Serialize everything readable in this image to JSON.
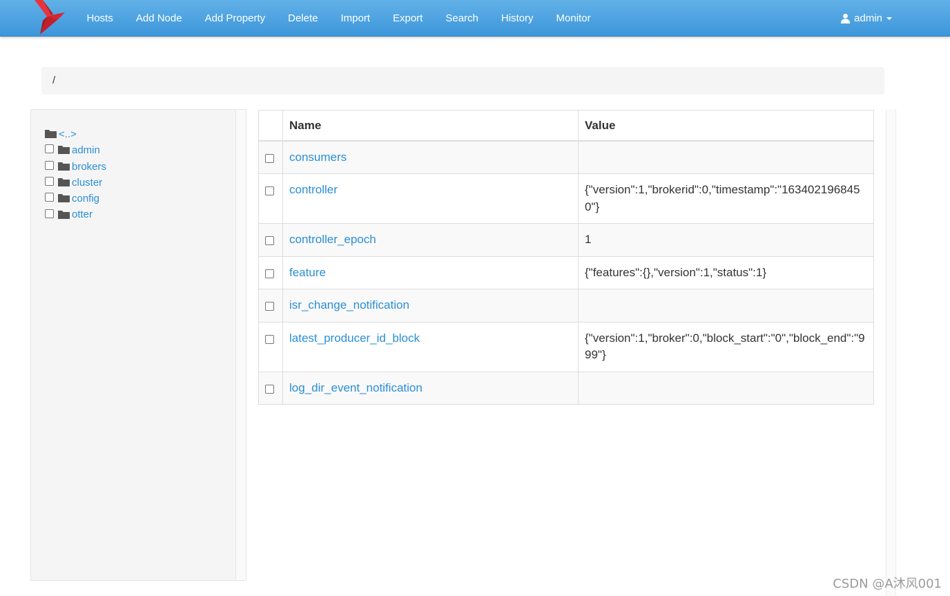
{
  "navbar": {
    "brand_icon": "bird-logo-icon",
    "links": [
      "Hosts",
      "Add Node",
      "Add Property",
      "Delete",
      "Import",
      "Export",
      "Search",
      "History",
      "Monitor"
    ],
    "user": {
      "icon": "user-icon",
      "name": "admin"
    }
  },
  "breadcrumb": {
    "path": "/"
  },
  "tree": {
    "parent_label": "<..>",
    "items": [
      {
        "label": "admin",
        "checked": false
      },
      {
        "label": "brokers",
        "checked": false
      },
      {
        "label": "cluster",
        "checked": false
      },
      {
        "label": "config",
        "checked": false
      },
      {
        "label": "otter",
        "checked": false
      }
    ]
  },
  "table": {
    "headers": {
      "name": "Name",
      "value": "Value"
    },
    "rows": [
      {
        "name": "consumers",
        "value": "",
        "checked": false
      },
      {
        "name": "controller",
        "value": "{\"version\":1,\"brokerid\":0,\"timestamp\":\"1634021968450\"}",
        "checked": false
      },
      {
        "name": "controller_epoch",
        "value": "1",
        "checked": false
      },
      {
        "name": "feature",
        "value": "{\"features\":{},\"version\":1,\"status\":1}",
        "checked": false
      },
      {
        "name": "isr_change_notification",
        "value": "",
        "checked": false
      },
      {
        "name": "latest_producer_id_block",
        "value": "{\"version\":1,\"broker\":0,\"block_start\":\"0\",\"block_end\":\"999\"}",
        "checked": false
      },
      {
        "name": "log_dir_event_notification",
        "value": "",
        "checked": false
      }
    ]
  },
  "watermark": "CSDN @A沐风001",
  "colors": {
    "navbar_top": "#62b1e8",
    "navbar_bottom": "#3d96da",
    "link": "#2a8ed6",
    "logo_red": "#d9232d"
  }
}
